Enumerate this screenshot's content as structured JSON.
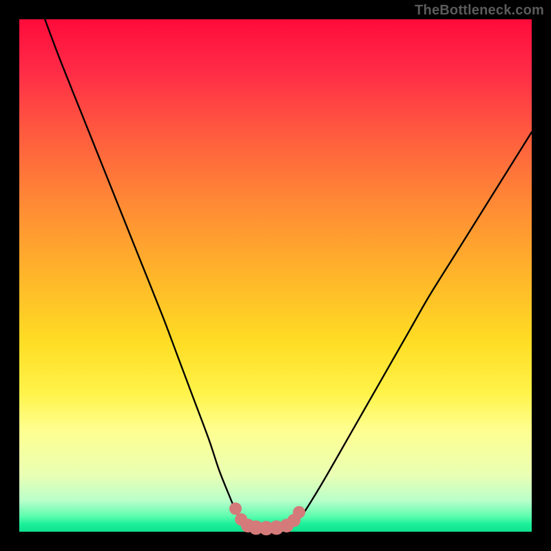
{
  "watermark": "TheBottleneck.com",
  "colors": {
    "curve": "#000000",
    "marker_fill": "#d57a7a",
    "marker_stroke": "#b85e5e"
  },
  "chart_data": {
    "type": "line",
    "title": "",
    "xlabel": "",
    "ylabel": "",
    "xlim": [
      0,
      100
    ],
    "ylim": [
      0,
      100
    ],
    "series": [
      {
        "name": "curve",
        "x": [
          5,
          8,
          12,
          16,
          20,
          24,
          28,
          31,
          34,
          37,
          39,
          41,
          42.5,
          44,
          45.5,
          47,
          49,
          51,
          53,
          55,
          57,
          60,
          64,
          68,
          72,
          76,
          80,
          85,
          90,
          95,
          100
        ],
        "y": [
          100,
          92,
          82,
          72,
          62,
          52,
          42,
          34,
          26,
          18,
          12,
          7,
          3.5,
          1.5,
          0.8,
          0.5,
          0.5,
          0.6,
          1.2,
          3,
          6,
          11,
          18,
          25,
          32,
          39,
          46,
          54,
          62,
          70,
          78
        ]
      }
    ],
    "markers": {
      "name": "valley-markers",
      "x": [
        42.2,
        43.3,
        44.6,
        46.2,
        48.2,
        50.2,
        52.2,
        53.6,
        54.6
      ],
      "y": [
        4.5,
        2.4,
        1.2,
        0.8,
        0.7,
        0.8,
        1.2,
        2.2,
        3.8
      ],
      "r": [
        9,
        9,
        10,
        10.5,
        10.5,
        10.5,
        10,
        9.5,
        9
      ]
    }
  }
}
